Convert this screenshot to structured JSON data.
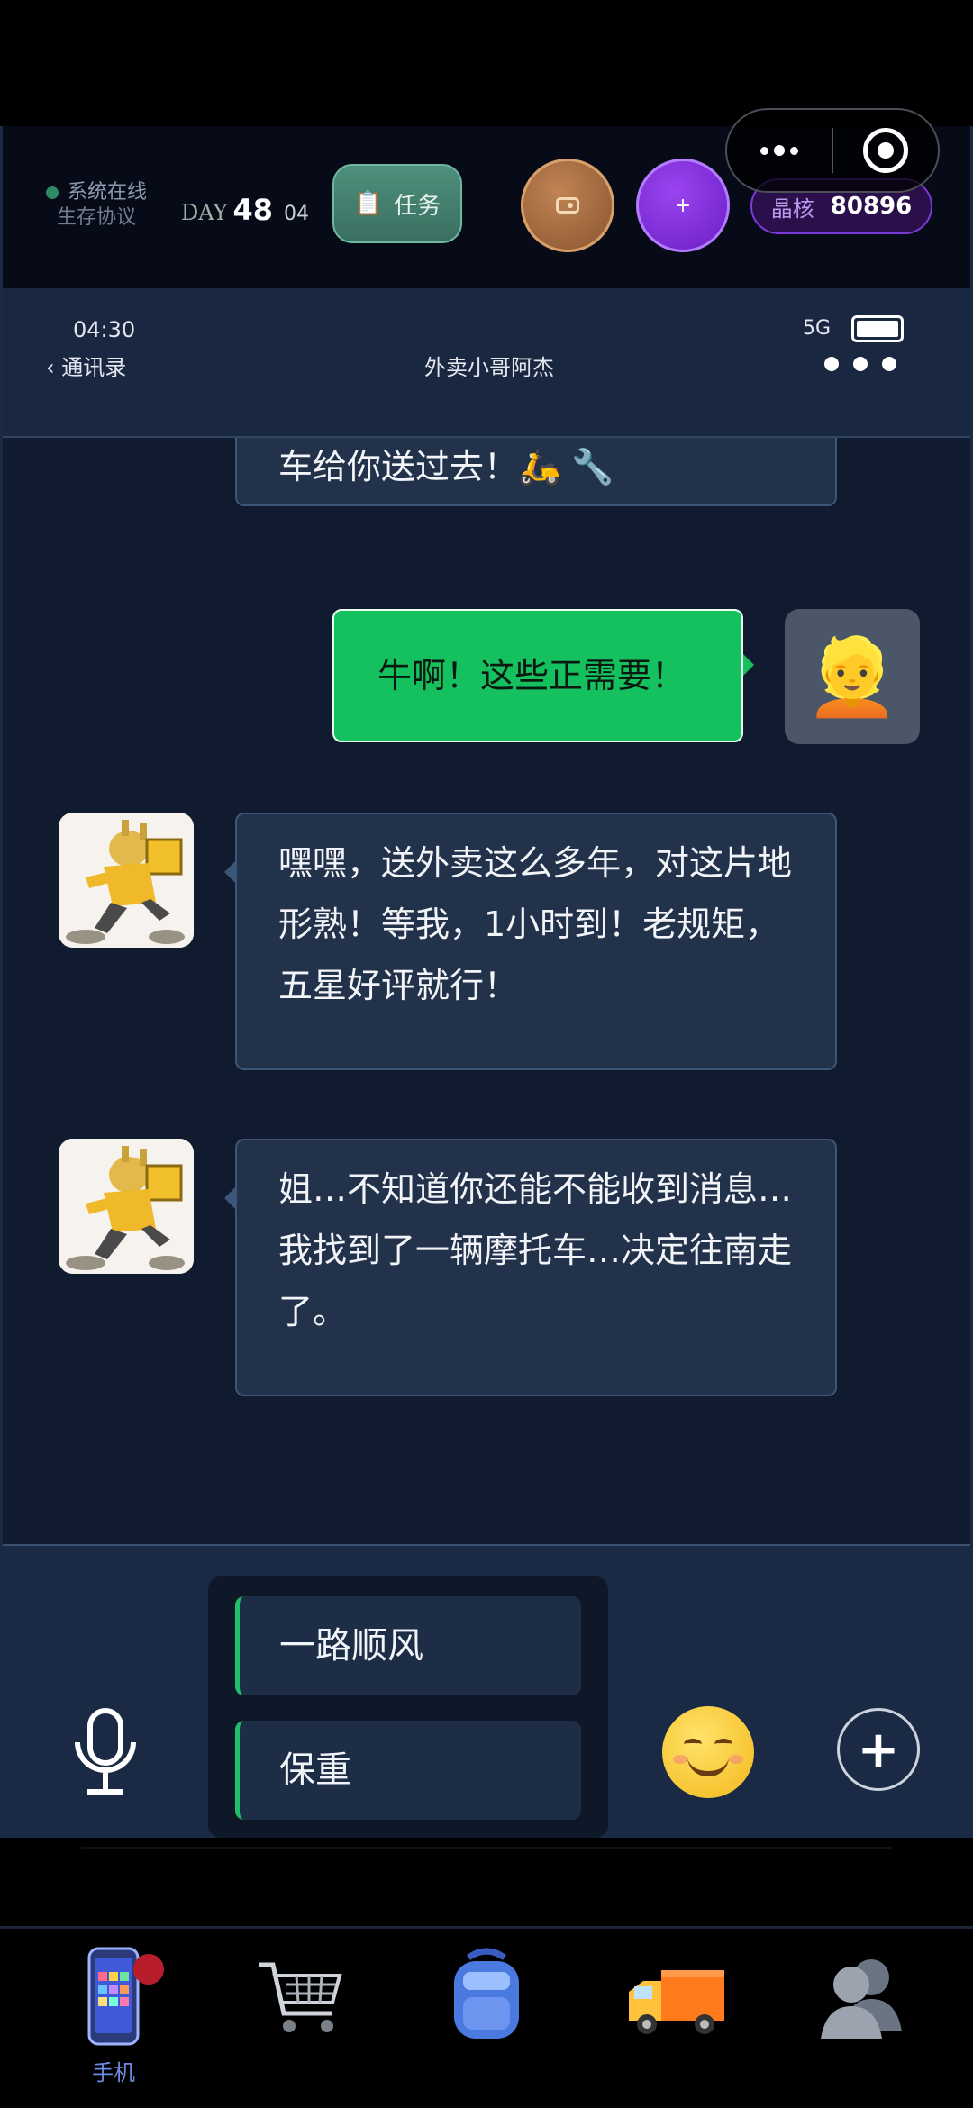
{
  "status_bar": {
    "online_label": "系统在线",
    "protocol_label": "生存协议",
    "day_prefix": "DAY",
    "day_number": "48",
    "time_small": "04",
    "task_label": "任务",
    "task_icon": "clipboard-icon",
    "radio_icon": "radio-icon",
    "plus_label": "+",
    "crystal_label": "晶核",
    "crystal_value": "80896"
  },
  "phone_header": {
    "time": "04:30",
    "back_label": "通讯录",
    "contact_name": "外卖小哥阿杰",
    "network": "5G",
    "battery_level": 1.0
  },
  "messages": [
    {
      "from": "contact",
      "text": "车给你送过去！🛵 🔧"
    },
    {
      "from": "me",
      "text": "牛啊！这些正需要！",
      "avatar": "👱"
    },
    {
      "from": "contact",
      "text": "嘿嘿，送外卖这么多年，对这片地形熟！等我，1小时到！老规矩，五星好评就行！"
    },
    {
      "from": "contact",
      "text": "姐…不知道你还能不能收到消息…我找到了一辆摩托车…决定往南走了。"
    }
  ],
  "quick_replies": [
    "一路顺风",
    "保重"
  ],
  "input_bar": {
    "mic_icon": "microphone-icon",
    "emoji_icon": "smiling-face-icon",
    "add_label": "+"
  },
  "bottom_nav": [
    {
      "icon": "phone-icon",
      "label": "手机",
      "active": true,
      "badge": true
    },
    {
      "icon": "shopping-cart-icon",
      "label": ""
    },
    {
      "icon": "backpack-icon",
      "label": ""
    },
    {
      "icon": "delivery-truck-icon",
      "label": ""
    },
    {
      "icon": "contacts-icon",
      "label": ""
    }
  ],
  "colors": {
    "accent_green": "#15c05f",
    "crystal_purple": "#7c3ad6",
    "badge_red": "#b81d2c",
    "bubble_bg": "#22324b"
  }
}
